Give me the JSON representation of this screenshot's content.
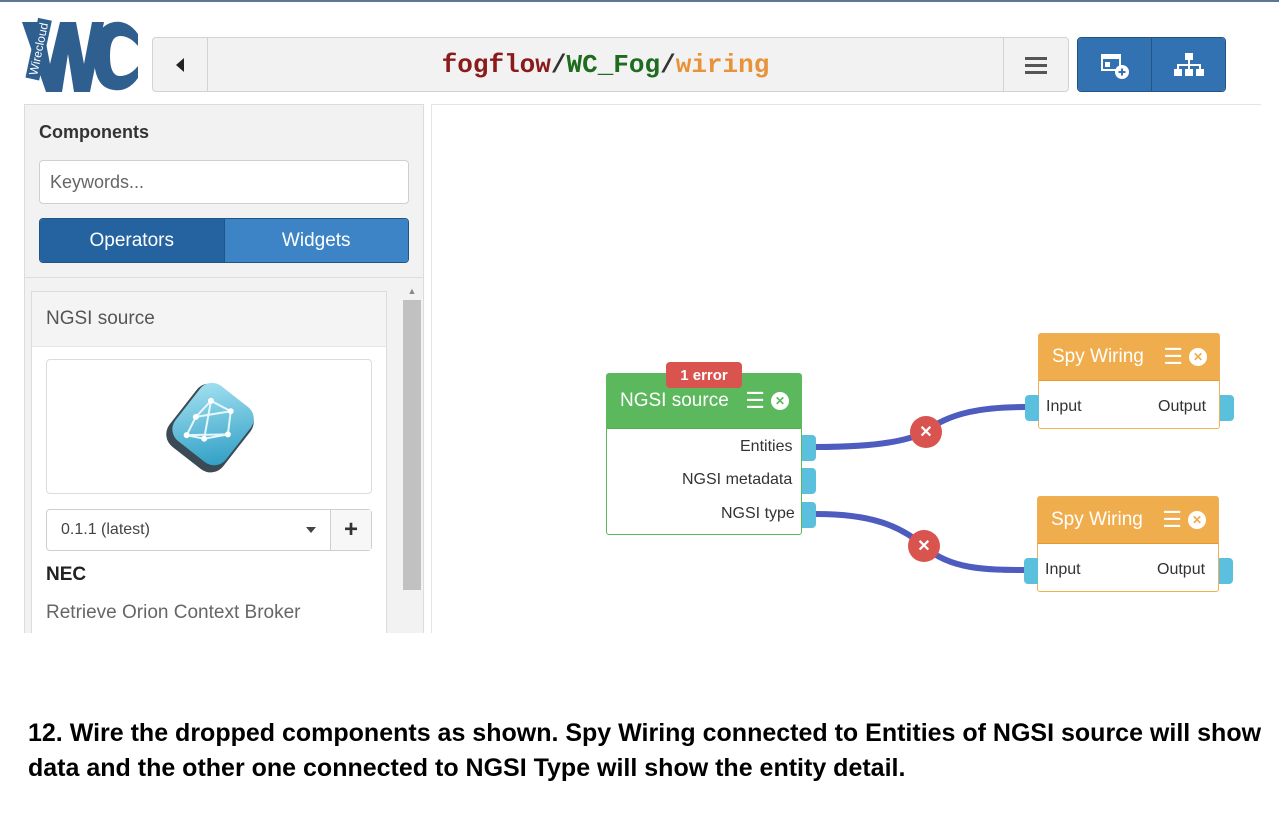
{
  "header": {
    "logo_text": "Wirecloud",
    "path": {
      "owner": "fogflow",
      "separator": "/",
      "workspace": "WC_Fog",
      "view": "wiring"
    }
  },
  "sidebar": {
    "title": "Components",
    "search_placeholder": "Keywords...",
    "tabs": [
      {
        "label": "Operators",
        "active": true
      },
      {
        "label": "Widgets",
        "active": false
      }
    ],
    "component": {
      "name": "NGSI source",
      "version": "0.1.1 (latest)",
      "add_label": "+",
      "vendor": "NEC",
      "description": "Retrieve Orion Context Broker"
    }
  },
  "canvas": {
    "ngsi_source": {
      "title": "NGSI source",
      "error_badge": "1 error",
      "outputs": [
        "Entities",
        "NGSI metadata",
        "NGSI type"
      ]
    },
    "spy_wiring_1": {
      "title": "Spy Wiring",
      "input": "Input",
      "output": "Output"
    },
    "spy_wiring_2": {
      "title": "Spy Wiring",
      "input": "Input",
      "output": "Output"
    }
  },
  "caption": "12. Wire the dropped components as shown. Spy Wiring connected to Entities of NGSI source will show data and the other one connected to NGSI Type will show the entity detail.",
  "colors": {
    "primary": "#3272b3",
    "operator_green": "#5cb85c",
    "widget_orange": "#f0ad4e",
    "error_red": "#d9534f",
    "wire": "#4e5bbf",
    "endpoint": "#5bc0de"
  }
}
